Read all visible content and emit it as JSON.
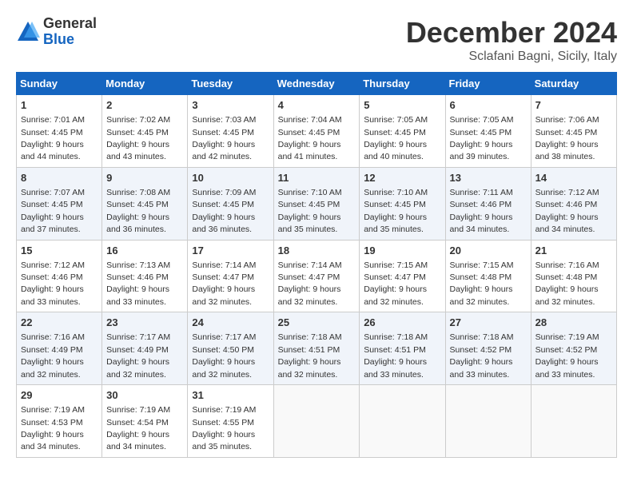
{
  "logo": {
    "general": "General",
    "blue": "Blue"
  },
  "title": "December 2024",
  "subtitle": "Sclafani Bagni, Sicily, Italy",
  "days_of_week": [
    "Sunday",
    "Monday",
    "Tuesday",
    "Wednesday",
    "Thursday",
    "Friday",
    "Saturday"
  ],
  "weeks": [
    [
      {
        "day": 1,
        "sunrise": "7:01 AM",
        "sunset": "4:45 PM",
        "daylight": "9 hours and 44 minutes."
      },
      {
        "day": 2,
        "sunrise": "7:02 AM",
        "sunset": "4:45 PM",
        "daylight": "9 hours and 43 minutes."
      },
      {
        "day": 3,
        "sunrise": "7:03 AM",
        "sunset": "4:45 PM",
        "daylight": "9 hours and 42 minutes."
      },
      {
        "day": 4,
        "sunrise": "7:04 AM",
        "sunset": "4:45 PM",
        "daylight": "9 hours and 41 minutes."
      },
      {
        "day": 5,
        "sunrise": "7:05 AM",
        "sunset": "4:45 PM",
        "daylight": "9 hours and 40 minutes."
      },
      {
        "day": 6,
        "sunrise": "7:05 AM",
        "sunset": "4:45 PM",
        "daylight": "9 hours and 39 minutes."
      },
      {
        "day": 7,
        "sunrise": "7:06 AM",
        "sunset": "4:45 PM",
        "daylight": "9 hours and 38 minutes."
      }
    ],
    [
      {
        "day": 8,
        "sunrise": "7:07 AM",
        "sunset": "4:45 PM",
        "daylight": "9 hours and 37 minutes."
      },
      {
        "day": 9,
        "sunrise": "7:08 AM",
        "sunset": "4:45 PM",
        "daylight": "9 hours and 36 minutes."
      },
      {
        "day": 10,
        "sunrise": "7:09 AM",
        "sunset": "4:45 PM",
        "daylight": "9 hours and 36 minutes."
      },
      {
        "day": 11,
        "sunrise": "7:10 AM",
        "sunset": "4:45 PM",
        "daylight": "9 hours and 35 minutes."
      },
      {
        "day": 12,
        "sunrise": "7:10 AM",
        "sunset": "4:45 PM",
        "daylight": "9 hours and 35 minutes."
      },
      {
        "day": 13,
        "sunrise": "7:11 AM",
        "sunset": "4:46 PM",
        "daylight": "9 hours and 34 minutes."
      },
      {
        "day": 14,
        "sunrise": "7:12 AM",
        "sunset": "4:46 PM",
        "daylight": "9 hours and 34 minutes."
      }
    ],
    [
      {
        "day": 15,
        "sunrise": "7:12 AM",
        "sunset": "4:46 PM",
        "daylight": "9 hours and 33 minutes."
      },
      {
        "day": 16,
        "sunrise": "7:13 AM",
        "sunset": "4:46 PM",
        "daylight": "9 hours and 33 minutes."
      },
      {
        "day": 17,
        "sunrise": "7:14 AM",
        "sunset": "4:47 PM",
        "daylight": "9 hours and 32 minutes."
      },
      {
        "day": 18,
        "sunrise": "7:14 AM",
        "sunset": "4:47 PM",
        "daylight": "9 hours and 32 minutes."
      },
      {
        "day": 19,
        "sunrise": "7:15 AM",
        "sunset": "4:47 PM",
        "daylight": "9 hours and 32 minutes."
      },
      {
        "day": 20,
        "sunrise": "7:15 AM",
        "sunset": "4:48 PM",
        "daylight": "9 hours and 32 minutes."
      },
      {
        "day": 21,
        "sunrise": "7:16 AM",
        "sunset": "4:48 PM",
        "daylight": "9 hours and 32 minutes."
      }
    ],
    [
      {
        "day": 22,
        "sunrise": "7:16 AM",
        "sunset": "4:49 PM",
        "daylight": "9 hours and 32 minutes."
      },
      {
        "day": 23,
        "sunrise": "7:17 AM",
        "sunset": "4:49 PM",
        "daylight": "9 hours and 32 minutes."
      },
      {
        "day": 24,
        "sunrise": "7:17 AM",
        "sunset": "4:50 PM",
        "daylight": "9 hours and 32 minutes."
      },
      {
        "day": 25,
        "sunrise": "7:18 AM",
        "sunset": "4:51 PM",
        "daylight": "9 hours and 32 minutes."
      },
      {
        "day": 26,
        "sunrise": "7:18 AM",
        "sunset": "4:51 PM",
        "daylight": "9 hours and 33 minutes."
      },
      {
        "day": 27,
        "sunrise": "7:18 AM",
        "sunset": "4:52 PM",
        "daylight": "9 hours and 33 minutes."
      },
      {
        "day": 28,
        "sunrise": "7:19 AM",
        "sunset": "4:52 PM",
        "daylight": "9 hours and 33 minutes."
      }
    ],
    [
      {
        "day": 29,
        "sunrise": "7:19 AM",
        "sunset": "4:53 PM",
        "daylight": "9 hours and 34 minutes."
      },
      {
        "day": 30,
        "sunrise": "7:19 AM",
        "sunset": "4:54 PM",
        "daylight": "9 hours and 34 minutes."
      },
      {
        "day": 31,
        "sunrise": "7:19 AM",
        "sunset": "4:55 PM",
        "daylight": "9 hours and 35 minutes."
      },
      null,
      null,
      null,
      null
    ]
  ]
}
